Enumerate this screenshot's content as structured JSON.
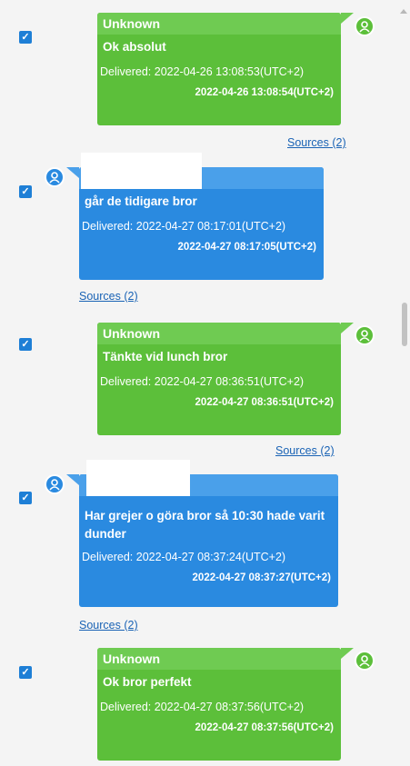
{
  "messages": [
    {
      "side": "right",
      "sender": "Unknown",
      "text": "Ok absolut",
      "delivered": "Delivered: 2022-04-26 13:08:53(UTC+2)",
      "timestamp": "2022-04-26 13:08:54(UTC+2)",
      "sources": "Sources (2)",
      "checked": true
    },
    {
      "side": "left",
      "sender": "",
      "text": "går de tidigare bror",
      "delivered": "Delivered: 2022-04-27 08:17:01(UTC+2)",
      "timestamp": "2022-04-27 08:17:05(UTC+2)",
      "sources": "Sources (2)",
      "checked": true
    },
    {
      "side": "right",
      "sender": "Unknown",
      "text": "Tänkte vid lunch bror",
      "delivered": "Delivered: 2022-04-27 08:36:51(UTC+2)",
      "timestamp": "2022-04-27 08:36:51(UTC+2)",
      "sources": "Sources (2)",
      "checked": true
    },
    {
      "side": "left",
      "sender": "",
      "text": "Har grejer o göra bror så 10:30 hade varit dunder",
      "delivered": "Delivered: 2022-04-27 08:37:24(UTC+2)",
      "timestamp": "2022-04-27 08:37:27(UTC+2)",
      "sources": "Sources (2)",
      "checked": true
    },
    {
      "side": "right",
      "sender": "Unknown",
      "text": "Ok bror perfekt",
      "delivered": "Delivered: 2022-04-27 08:37:56(UTC+2)",
      "timestamp": "2022-04-27 08:37:56(UTC+2)",
      "checked": true
    }
  ],
  "colors": {
    "incoming_bubble": "#5cbf3a",
    "outgoing_bubble": "#2a8ae0",
    "checkbox": "#1e7fd6",
    "link": "#1a63b5"
  },
  "icons": {
    "avatar": "person-icon",
    "checkbox": "checkmark-icon"
  }
}
